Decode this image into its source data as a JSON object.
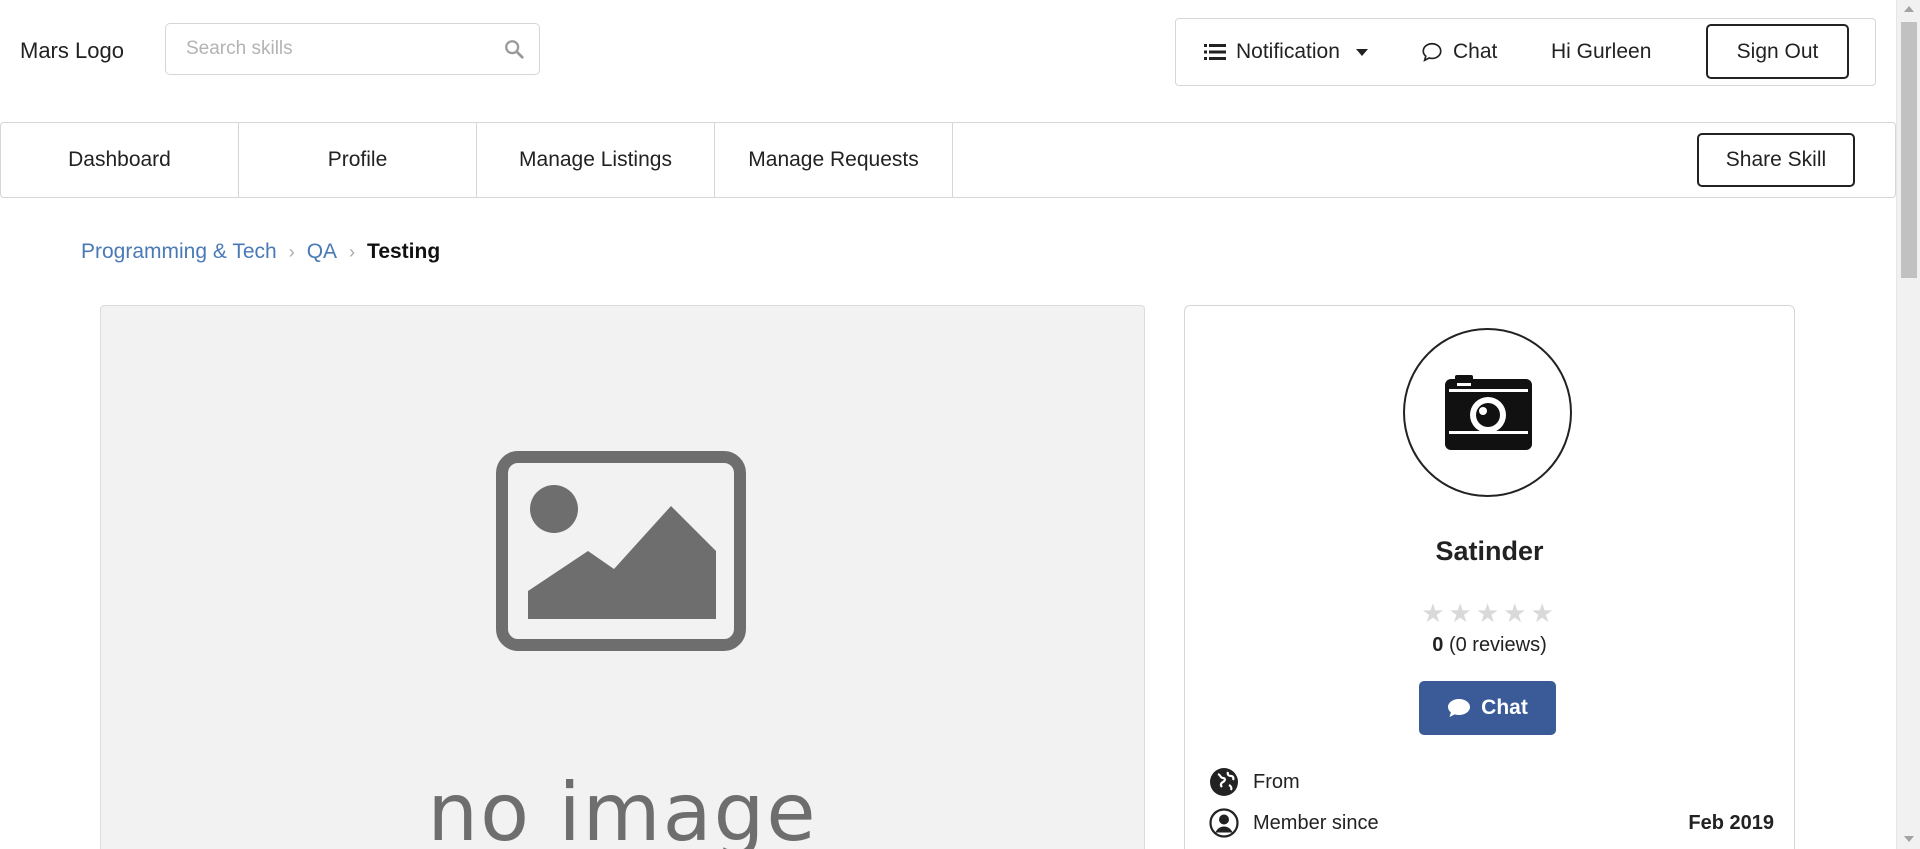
{
  "header": {
    "logo": "Mars Logo",
    "search": {
      "placeholder": "Search skills",
      "value": ""
    },
    "notification_label": "Notification",
    "chat_label": "Chat",
    "greeting": "Hi Gurleen",
    "sign_out_label": "Sign Out"
  },
  "nav": {
    "tabs": [
      {
        "label": "Dashboard"
      },
      {
        "label": "Profile"
      },
      {
        "label": "Manage Listings"
      },
      {
        "label": "Manage Requests"
      }
    ],
    "share_skill_label": "Share Skill"
  },
  "breadcrumb": {
    "items": [
      "Programming & Tech",
      "QA",
      "Testing"
    ],
    "separator": "›"
  },
  "image_panel": {
    "placeholder_text": "no image"
  },
  "seller": {
    "name": "Satinder",
    "rating_value": "0",
    "reviews_text": "(0 reviews)",
    "stars": "★★★★★",
    "rating_stars": 0,
    "chat_button_label": "Chat",
    "from_label": "From",
    "member_since_label": "Member since",
    "member_since_value": "Feb 2019"
  },
  "colors": {
    "link": "#4a7ab5",
    "chat_button": "#3b5a98",
    "star_empty": "#d9d9d9",
    "placeholder_bg": "#f2f2f2"
  },
  "icons": {
    "search": "search-icon",
    "notification": "list-icon",
    "dropdown": "caret-down-icon",
    "chat": "chat-outline-icon",
    "avatar": "camera-icon",
    "chat_button": "chat-bubble-icon",
    "from": "globe-icon",
    "member": "user-circle-icon"
  }
}
